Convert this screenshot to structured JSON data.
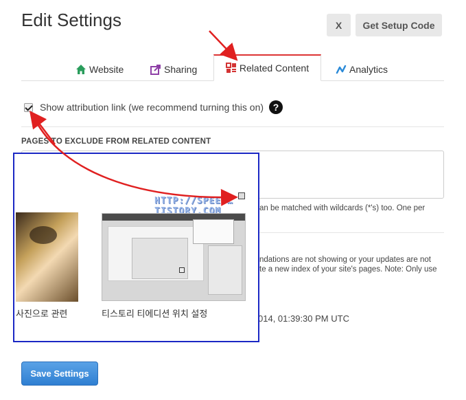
{
  "header": {
    "title": "Edit Settings",
    "close_label": "X",
    "setup_label": "Get Setup Code"
  },
  "tabs": [
    {
      "label": "Website",
      "icon": "home-icon",
      "color": "#2a9d5c"
    },
    {
      "label": "Sharing",
      "icon": "share-icon",
      "color": "#8e3fa6"
    },
    {
      "label": "Related Content",
      "icon": "related-content-icon",
      "color": "#d33333",
      "active": true
    },
    {
      "label": "Analytics",
      "icon": "analytics-icon",
      "color": "#2b8ad8"
    }
  ],
  "attribution": {
    "label": "Show attribution link (we recommend turning this on)",
    "checked": true,
    "help": "?"
  },
  "exclude": {
    "heading": "PAGES TO EXCLUDE FROM RELATED CONTENT",
    "helper": "an be matched with wildcards (*'s) too. One per"
  },
  "info": {
    "line1": "ndations are not showing or your updates are not",
    "line2": "te a new index of your site's pages. Note: Only use",
    "date": "014, 01:39:30 PM UTC"
  },
  "overlay": {
    "watermark": "HTTP://SPEED…TISTORY.COM",
    "caption1": "사진으로 관련",
    "caption2": "티스토리 티에디션 위치 설정"
  },
  "footer": {
    "save_label": "Save Settings"
  },
  "colors": {
    "accent_red": "#d33333",
    "save_blue": "#3a87d8",
    "overlay_border": "#1a27c4",
    "arrow_red": "#e02020"
  }
}
